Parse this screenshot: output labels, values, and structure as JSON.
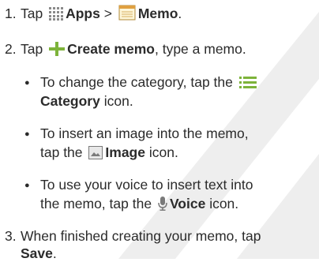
{
  "steps": {
    "s1": {
      "num": "1.",
      "tap": "Tap",
      "apps": "Apps",
      "sep": ">",
      "memo": "Memo",
      "end": "."
    },
    "s2": {
      "num": "2.",
      "tap": "Tap",
      "create": "Create memo",
      "rest": ", type a memo."
    },
    "s3": {
      "num": "3.",
      "text1": "When finished creating your memo, tap",
      "save": "Save",
      "end": "."
    }
  },
  "bullets": {
    "b1": {
      "text1": "To change the category, tap the",
      "category": "Category",
      "rest": " icon."
    },
    "b2": {
      "text1": "To insert an image into the memo,",
      "tapthe": "tap the",
      "image": "Image",
      "rest": " icon."
    },
    "b3": {
      "text1": "To use your voice to insert text into",
      "prefix": "the memo, tap the",
      "voice": "Voice",
      "rest": " icon."
    }
  },
  "icons": {
    "apps": "apps-grid-icon",
    "memo": "memo-icon",
    "create": "plus-icon",
    "category": "category-list-icon",
    "image": "image-icon",
    "voice": "microphone-icon"
  },
  "colors": {
    "icon_green": "#7db33a",
    "watermark": "#cfcfcf"
  }
}
